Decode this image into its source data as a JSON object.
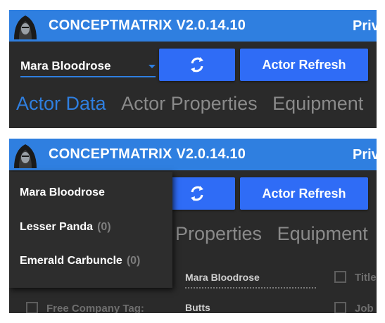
{
  "app": {
    "title": "CONCEPTMATRIX V2.0.14.10",
    "title_right": "Priv"
  },
  "toolbar": {
    "actor_selected": "Mara Bloodrose",
    "refresh_icon": "refresh-icon",
    "actor_refresh_label": "Actor Refresh"
  },
  "tabs": [
    {
      "label": "Actor Data",
      "active": true
    },
    {
      "label": "Actor Properties",
      "active": false
    },
    {
      "label": "Equipment",
      "active": false
    }
  ],
  "tabs_partial": [
    {
      "label": "Properties"
    },
    {
      "label": "Equipment"
    }
  ],
  "dropdown": {
    "items": [
      {
        "name": "Mara Bloodrose",
        "count": ""
      },
      {
        "name": "Lesser Panda",
        "count": "(0)"
      },
      {
        "name": "Emerald Carbuncle",
        "count": "(0)"
      }
    ]
  },
  "form": {
    "name_value": "Mara Bloodrose",
    "nickname_value": "Butts",
    "free_company_tag_label": "Free Company Tag:",
    "title_label": "Title",
    "job_label": "Job"
  },
  "colors": {
    "accent": "#2f7fe0",
    "button": "#2f6cf6",
    "background": "#2a2a2a"
  }
}
